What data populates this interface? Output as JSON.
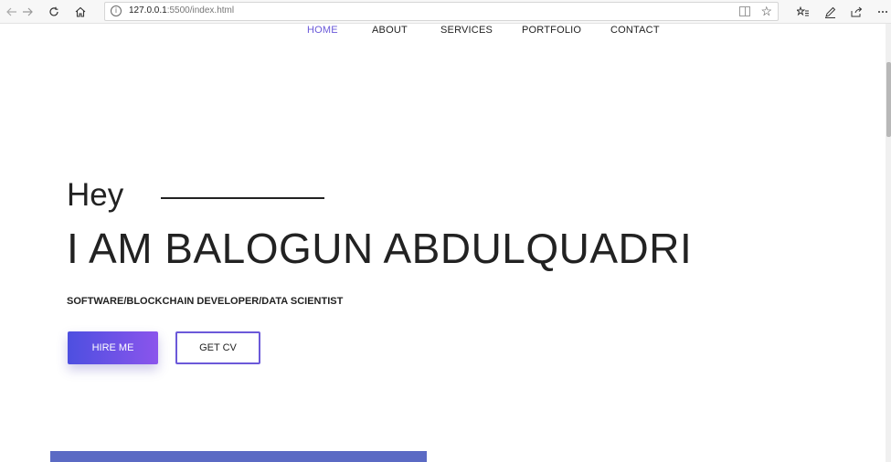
{
  "browser": {
    "url_host": "127.0.0.1",
    "url_rest": ":5500/index.html",
    "info_glyph": "i"
  },
  "nav": {
    "items": [
      "HOME",
      "ABOUT",
      "SERVICES",
      "PORTFOLIO",
      "CONTACT"
    ],
    "active": "HOME",
    "active_color": "#6a59d9"
  },
  "hero": {
    "greeting": "Hey",
    "title": "I AM BALOGUN ABDULQUADRI",
    "subtitle": "SOFTWARE/BLOCKCHAIN DEVELOPER/DATA SCIENTIST",
    "primary_button": "HIRE ME",
    "secondary_button": "GET CV",
    "accent_gradient": [
      "#4d4fe0",
      "#8b55ec"
    ],
    "section_color": "#5b6ac4"
  }
}
